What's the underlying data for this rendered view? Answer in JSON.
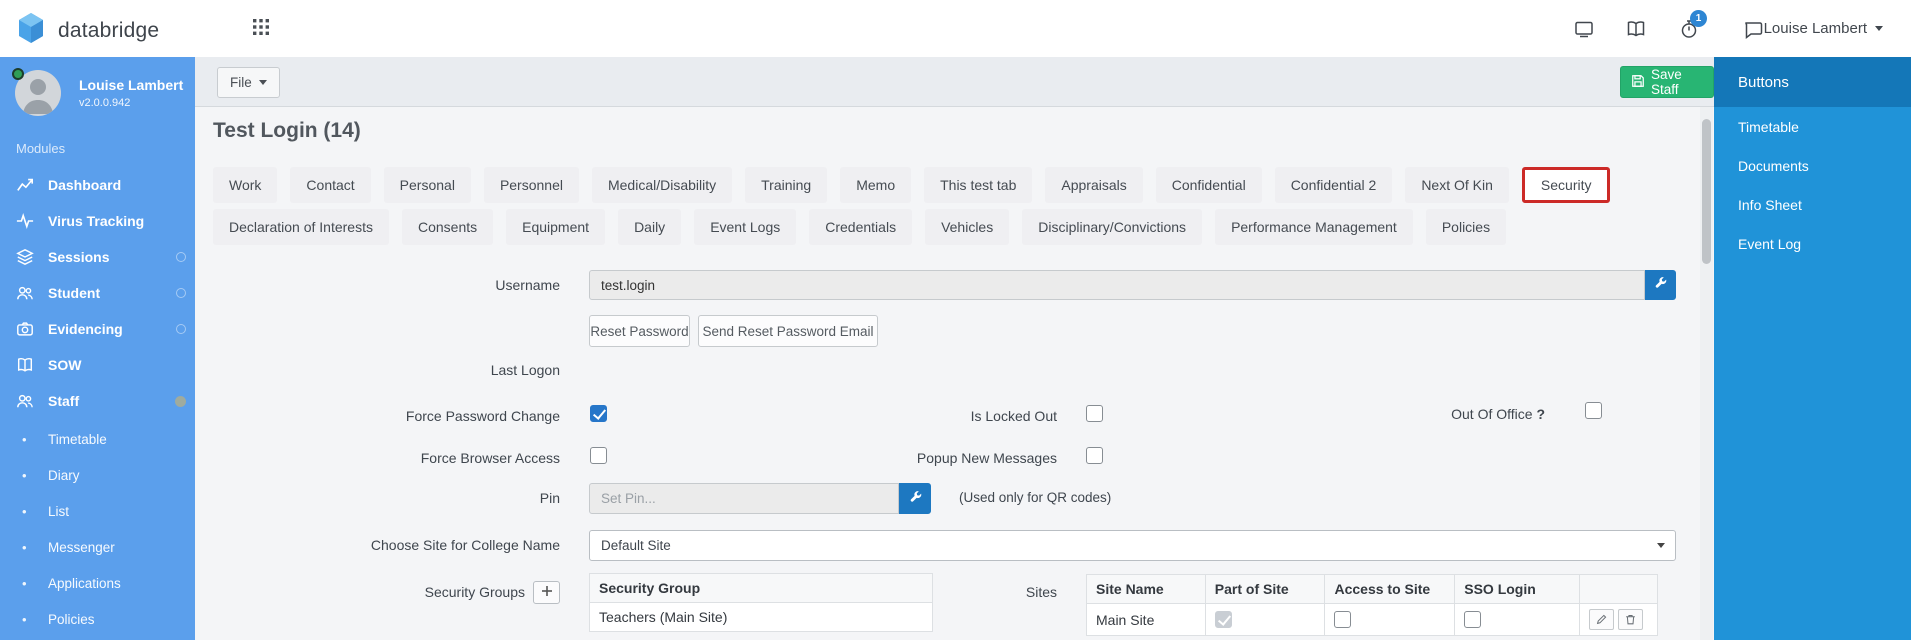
{
  "header": {
    "brand": "databridge",
    "notification_count": "1",
    "user_menu_label": "Louise Lambert"
  },
  "left_sidebar": {
    "user_name": "Louise Lambert",
    "version": "v2.0.0.942",
    "section_label": "Modules",
    "items": [
      {
        "label": "Dashboard",
        "icon": "chart-icon"
      },
      {
        "label": "Virus Tracking",
        "icon": "pulse-icon"
      },
      {
        "label": "Sessions",
        "icon": "layers-icon"
      },
      {
        "label": "Student",
        "icon": "users-icon"
      },
      {
        "label": "Evidencing",
        "icon": "camera-icon"
      },
      {
        "label": "SOW",
        "icon": "book-icon"
      },
      {
        "label": "Staff",
        "icon": "users-icon"
      }
    ],
    "sub_items": [
      "Timetable",
      "Diary",
      "List",
      "Messenger",
      "Applications",
      "Policies"
    ]
  },
  "toolbar": {
    "file_label": "File",
    "save_label": "Save Staff"
  },
  "page": {
    "title": "Test Login (14)"
  },
  "tabs_row1": [
    "Work",
    "Contact",
    "Personal",
    "Personnel",
    "Medical/Disability",
    "Training",
    "Memo",
    "This test tab",
    "Appraisals",
    "Confidential",
    "Confidential 2",
    "Next Of Kin",
    "Security"
  ],
  "tabs_row2": [
    "Declaration of Interests",
    "Consents",
    "Equipment",
    "Daily",
    "Event Logs",
    "Credentials",
    "Vehicles",
    "Disciplinary/Convictions",
    "Performance Management",
    "Policies"
  ],
  "active_tab": "Security",
  "form": {
    "username_label": "Username",
    "username_value": "test.login",
    "reset_password_label": "Reset Password",
    "send_reset_label": "Send Reset Password Email",
    "last_logon_label": "Last Logon",
    "force_password_change_label": "Force Password Change",
    "is_locked_out_label": "Is Locked Out",
    "out_of_office_label": "Out Of Office",
    "out_of_office_help": "?",
    "force_browser_access_label": "Force Browser Access",
    "popup_new_messages_label": "Popup New Messages",
    "pin_label": "Pin",
    "pin_placeholder": "Set Pin...",
    "qr_note": "(Used only for QR codes)",
    "choose_site_label": "Choose Site for College Name",
    "site_selected": "Default Site",
    "security_groups_label": "Security Groups",
    "sites_label": "Sites"
  },
  "checkboxes": {
    "force_password_change": true,
    "is_locked_out": false,
    "out_of_office": false,
    "force_browser_access": false,
    "popup_new_messages": false
  },
  "security_group_table": {
    "header": "Security Group",
    "row0": "Teachers (Main Site)"
  },
  "sites_table": {
    "headers": [
      "Site Name",
      "Part of Site",
      "Access to Site",
      "SSO Login"
    ],
    "row0": {
      "site_name": "Main Site",
      "part_of_site": true,
      "access_to_site": false,
      "sso_login": false
    }
  },
  "right_sidebar": {
    "title": "Buttons",
    "items": [
      "Timetable",
      "Documents",
      "Info Sheet",
      "Event Log"
    ]
  },
  "colors": {
    "sidebar_blue": "#5b9fec",
    "right_sidebar_blue": "#2093d8",
    "right_sidebar_header_blue": "#1477b8",
    "save_green": "#28b573",
    "tool_button_blue": "#1d78c1",
    "checkbox_blue": "#2676c9",
    "annotation_red": "#cc2a27",
    "badge_blue": "#2e86d3"
  }
}
